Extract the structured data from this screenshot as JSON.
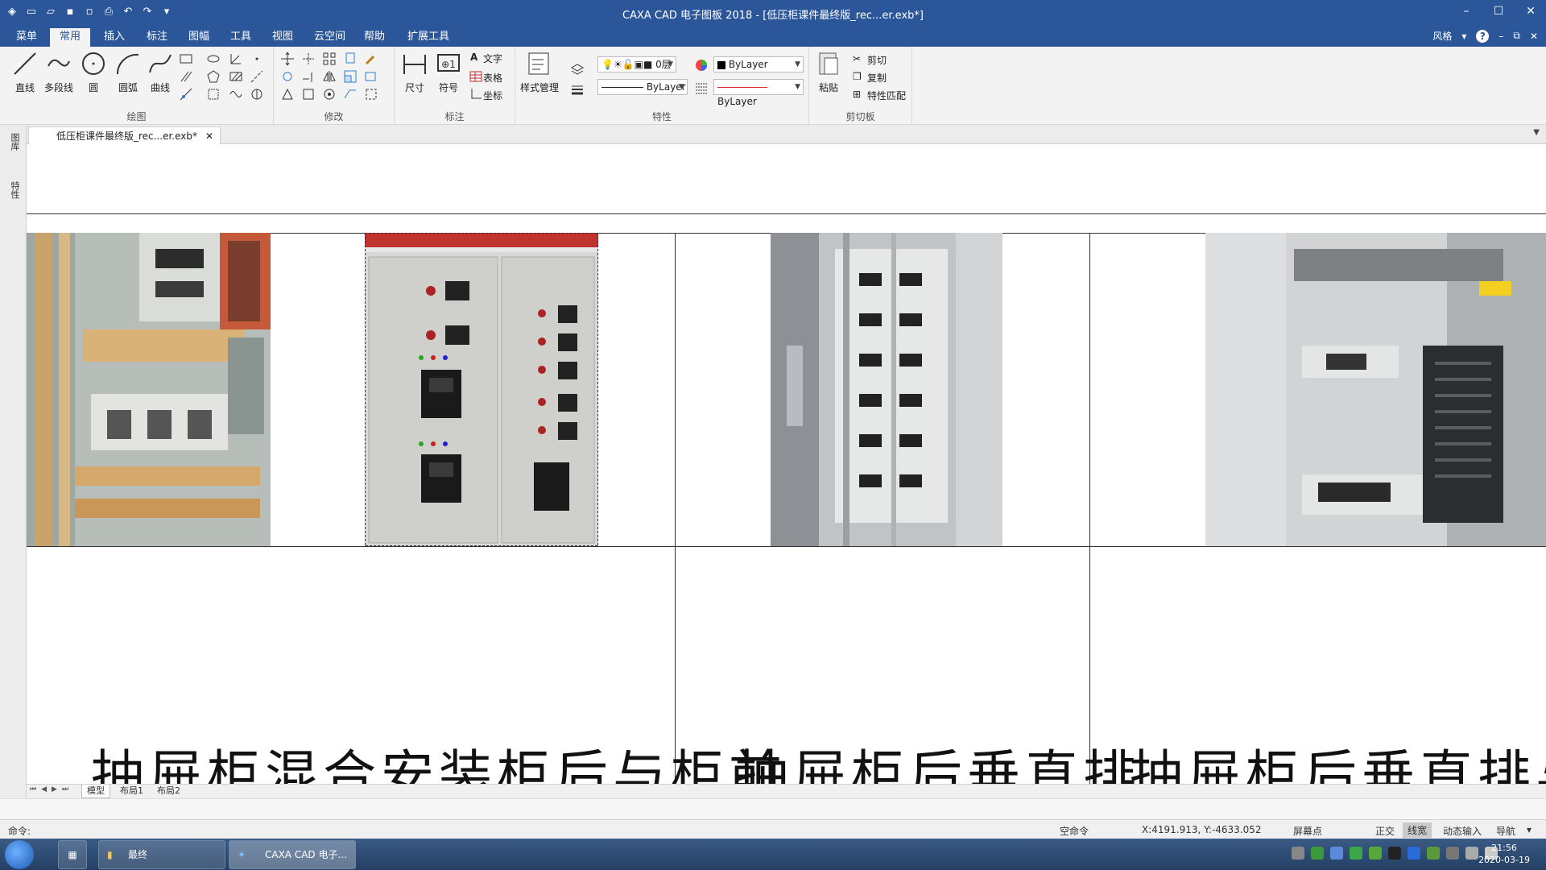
{
  "app": {
    "window_title": "CAXA CAD 电子图板 2018 - [低压柜课件最终版_rec...er.exb*]"
  },
  "ribbon_tabs": [
    "菜单",
    "常用",
    "插入",
    "标注",
    "图幅",
    "工具",
    "视图",
    "云空间",
    "帮助",
    "扩展工具"
  ],
  "active_tab": "常用",
  "style_label": "风格",
  "ribbon": {
    "draw": {
      "label": "绘图",
      "buttons": [
        "直线",
        "多段线",
        "圆",
        "圆弧",
        "曲线"
      ]
    },
    "modify": {
      "label": "修改"
    },
    "annotate": {
      "label": "标注",
      "buttons": [
        "尺寸",
        "符号"
      ],
      "small": [
        "文字",
        "表格",
        "坐标"
      ]
    },
    "properties": {
      "label": "特性",
      "style_manage": "样式管理",
      "layer": "0层",
      "color": "ByLayer",
      "linetype": "ByLayer",
      "lineweight": "ByLayer"
    },
    "clipboard": {
      "label": "剪切板",
      "paste": "粘贴",
      "cut": "剪切",
      "copy": "复制",
      "match": "特性匹配"
    }
  },
  "left_panel": [
    "图库",
    "特性"
  ],
  "document_tab": "低压柜课件最终版_rec...er.exb*",
  "canvas": {
    "captions": [
      "抽屉柜混合安装柜后与柜前",
      "抽屉柜后垂直排",
      "抽屉柜后垂直排与水"
    ]
  },
  "layout_tabs": [
    "模型",
    "布局1",
    "布局2"
  ],
  "active_layout": "模型",
  "status": {
    "command_prompt": "命令:",
    "idle": "空命令",
    "coords": "X:4191.913, Y:-4633.052",
    "snap": "屏幕点",
    "ortho": "正交",
    "lineweight": "线宽",
    "dynamic_input": "动态输入",
    "navigation": "导航"
  },
  "taskbar": {
    "folder_item": "最终",
    "app_item": "CAXA CAD 电子...",
    "time": "21:56",
    "date": "2020-03-19"
  },
  "colors": {
    "title_bar": "#2b579a",
    "ribbon_bg": "#f3f3f3",
    "linetype_red": "#e03030"
  }
}
